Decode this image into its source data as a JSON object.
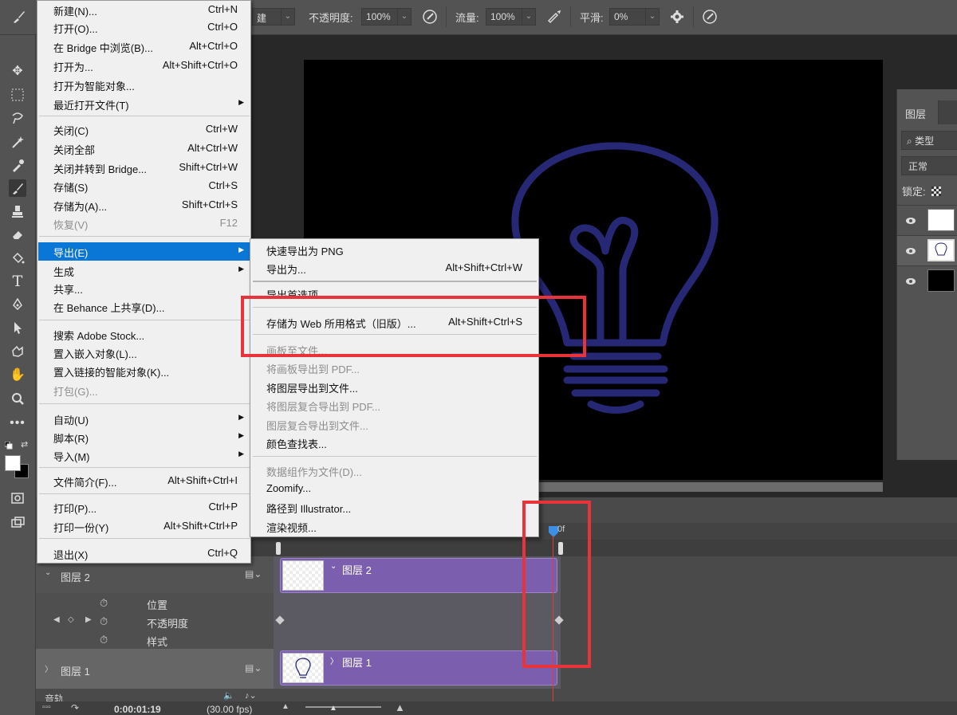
{
  "options_bar": {
    "opacity_label": "不透明度:",
    "opacity_value": "100%",
    "flow_label": "流量:",
    "flow_value": "100%",
    "smoothing_label": "平滑:",
    "smoothing_value": "0%",
    "mode_value": "建"
  },
  "file_menu": {
    "items": [
      {
        "label": "新建(N)...",
        "shortcut": "Ctrl+N"
      },
      {
        "label": "打开(O)...",
        "shortcut": "Ctrl+O"
      },
      {
        "label": "在 Bridge 中浏览(B)...",
        "shortcut": "Alt+Ctrl+O"
      },
      {
        "label": "打开为...",
        "shortcut": "Alt+Shift+Ctrl+O"
      },
      {
        "label": "打开为智能对象..."
      },
      {
        "label": "最近打开文件(T)"
      },
      {
        "label": "关闭(C)",
        "shortcut": "Ctrl+W"
      },
      {
        "label": "关闭全部",
        "shortcut": "Alt+Ctrl+W"
      },
      {
        "label": "关闭并转到 Bridge...",
        "shortcut": "Shift+Ctrl+W"
      },
      {
        "label": "存储(S)",
        "shortcut": "Ctrl+S"
      },
      {
        "label": "存储为(A)...",
        "shortcut": "Shift+Ctrl+S"
      },
      {
        "label": "恢复(V)",
        "shortcut": "F12"
      },
      {
        "label": "导出(E)"
      },
      {
        "label": "生成"
      },
      {
        "label": "共享..."
      },
      {
        "label": "在 Behance 上共享(D)..."
      },
      {
        "label": "搜索 Adobe Stock..."
      },
      {
        "label": "置入嵌入对象(L)..."
      },
      {
        "label": "置入链接的智能对象(K)..."
      },
      {
        "label": "打包(G)..."
      },
      {
        "label": "自动(U)"
      },
      {
        "label": "脚本(R)"
      },
      {
        "label": "导入(M)"
      },
      {
        "label": "文件简介(F)...",
        "shortcut": "Alt+Shift+Ctrl+I"
      },
      {
        "label": "打印(P)...",
        "shortcut": "Ctrl+P"
      },
      {
        "label": "打印一份(Y)",
        "shortcut": "Alt+Shift+Ctrl+P"
      },
      {
        "label": "退出(X)",
        "shortcut": "Ctrl+Q"
      }
    ]
  },
  "export_menu": {
    "items": [
      {
        "label": "快速导出为 PNG"
      },
      {
        "label": "导出为...",
        "shortcut": "Alt+Shift+Ctrl+W"
      },
      {
        "label": "导出首选项..."
      },
      {
        "label": "存储为 Web 所用格式（旧版）...",
        "shortcut": "Alt+Shift+Ctrl+S"
      },
      {
        "label": "画板至文件..."
      },
      {
        "label": "将画板导出到 PDF..."
      },
      {
        "label": "将图层导出到文件..."
      },
      {
        "label": "将图层复合导出到 PDF..."
      },
      {
        "label": "图层复合导出到文件..."
      },
      {
        "label": "颜色查找表..."
      },
      {
        "label": "数据组作为文件(D)..."
      },
      {
        "label": "Zoomify..."
      },
      {
        "label": "路径到 Illustrator..."
      },
      {
        "label": "渲染视频..."
      }
    ]
  },
  "layers_panel": {
    "tab": "图层",
    "search": "类型",
    "blend_mode": "正常",
    "lock_label": "锁定:"
  },
  "timeline": {
    "playhead_label": "0f",
    "layer2_name": "图层 2",
    "layer1_name": "图层 1",
    "prop_position": "位置",
    "prop_opacity": "不透明度",
    "prop_style": "样式",
    "clip2_name": "图层 2",
    "clip1_name": "图层 1",
    "audio_label": "音轨",
    "timecode": "0:00:01:19",
    "fps": "(30.00 fps)"
  },
  "colors": {
    "menu_highlight": "#0a76d6",
    "annotation_red": "#e8333a",
    "bulb_stroke": "#262775",
    "clip_purple": "#7b5fae"
  }
}
